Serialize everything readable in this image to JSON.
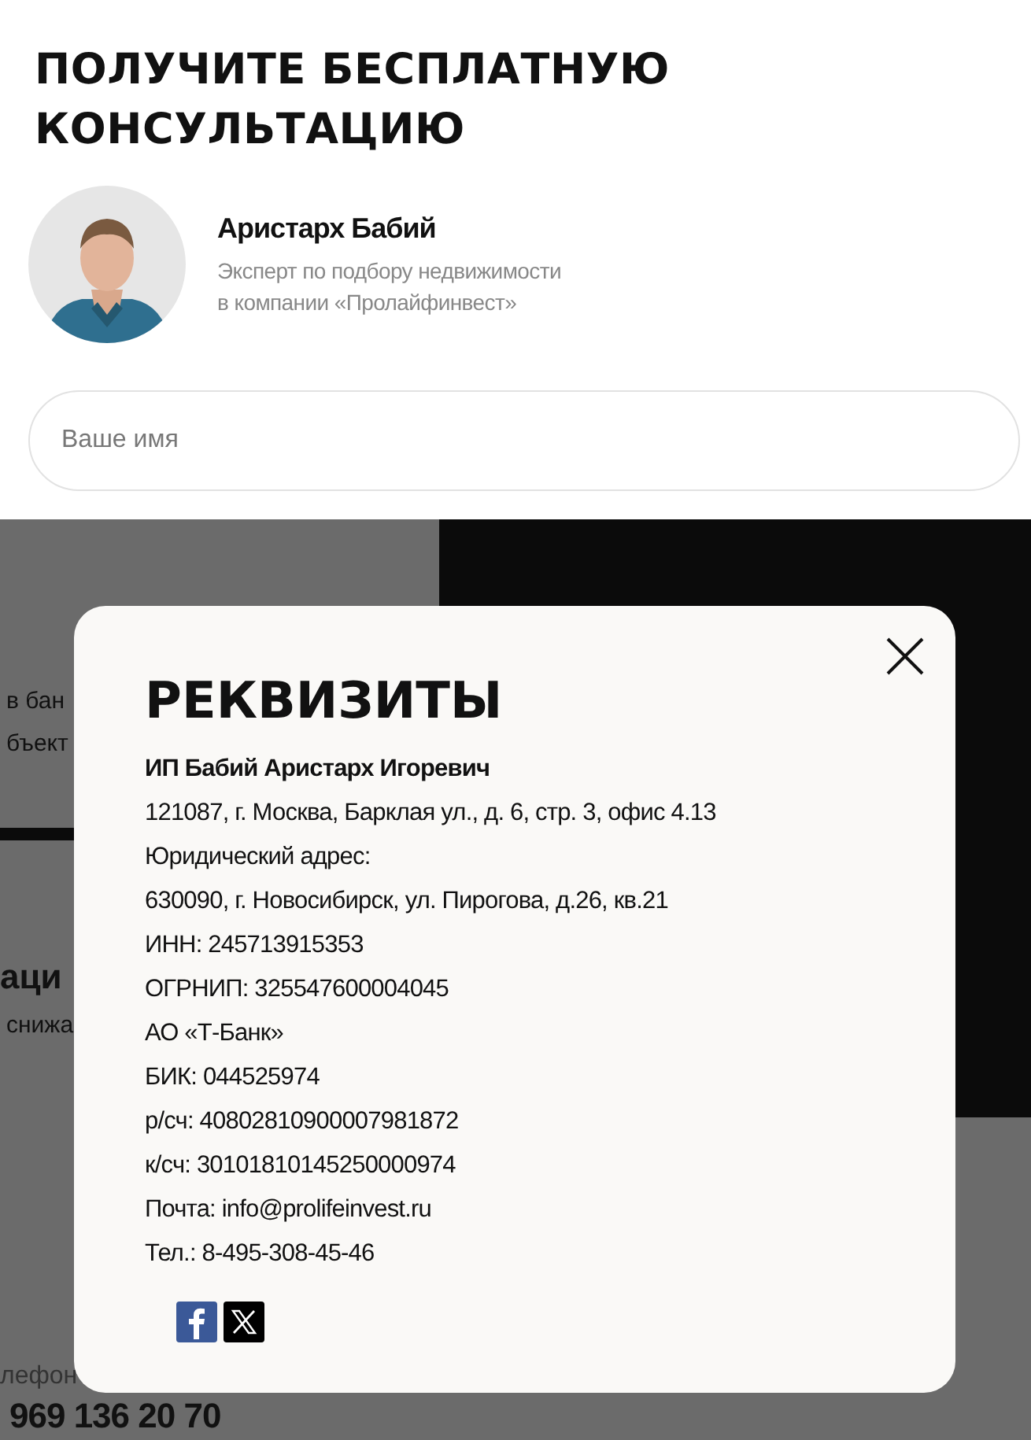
{
  "consultation": {
    "title": "ПОЛУЧИТЕ БЕСПЛАТНУЮ КОНСУЛЬТАЦИЮ",
    "expert": {
      "name": "Аристарх Бабий",
      "role_lines": [
        "Эксперт по подбору недвижимости",
        "в компании «Пролайфинвест»"
      ]
    },
    "name_field": {
      "placeholder": "Ваше имя"
    }
  },
  "background_fragments": [
    {
      "kind": "text",
      "text": "в бан"
    },
    {
      "kind": "text",
      "text": "бъект"
    },
    {
      "kind": "heading",
      "text": "аци"
    },
    {
      "kind": "text",
      "text": "снижа"
    },
    {
      "kind": "label",
      "text": "лефон"
    },
    {
      "kind": "phone",
      "text": "969 136 20 70"
    }
  ],
  "modal": {
    "title": "РЕКВИЗИТЫ",
    "lines": [
      {
        "text": "ИП Бабий Аристарх Игоревич",
        "bold": true
      },
      {
        "text": "121087, г. Москва, Барклая ул., д. 6, стр. 3, офис 4.13",
        "bold": false
      },
      {
        "text": "Юридический адрес:",
        "bold": false
      },
      {
        "text": "630090, г. Новосибирск, ул. Пирогова, д.26, кв.21",
        "bold": false
      },
      {
        "text": "ИНН: 245713915353",
        "bold": false
      },
      {
        "text": "ОГРНИП: 325547600004045",
        "bold": false
      },
      {
        "text": "АО «Т-Банк»",
        "bold": false
      },
      {
        "text": "БИК: 044525974",
        "bold": false
      },
      {
        "text": "р/сч: 40802810900007981872",
        "bold": false
      },
      {
        "text": "к/сч: 30101810145250000974",
        "bold": false
      },
      {
        "text": "Почта: info@prolifeinvest.ru",
        "bold": false
      },
      {
        "text": "Тел.: 8-495-308-45-46",
        "bold": false
      }
    ],
    "share": [
      {
        "kind": "facebook"
      },
      {
        "kind": "x"
      }
    ]
  }
}
